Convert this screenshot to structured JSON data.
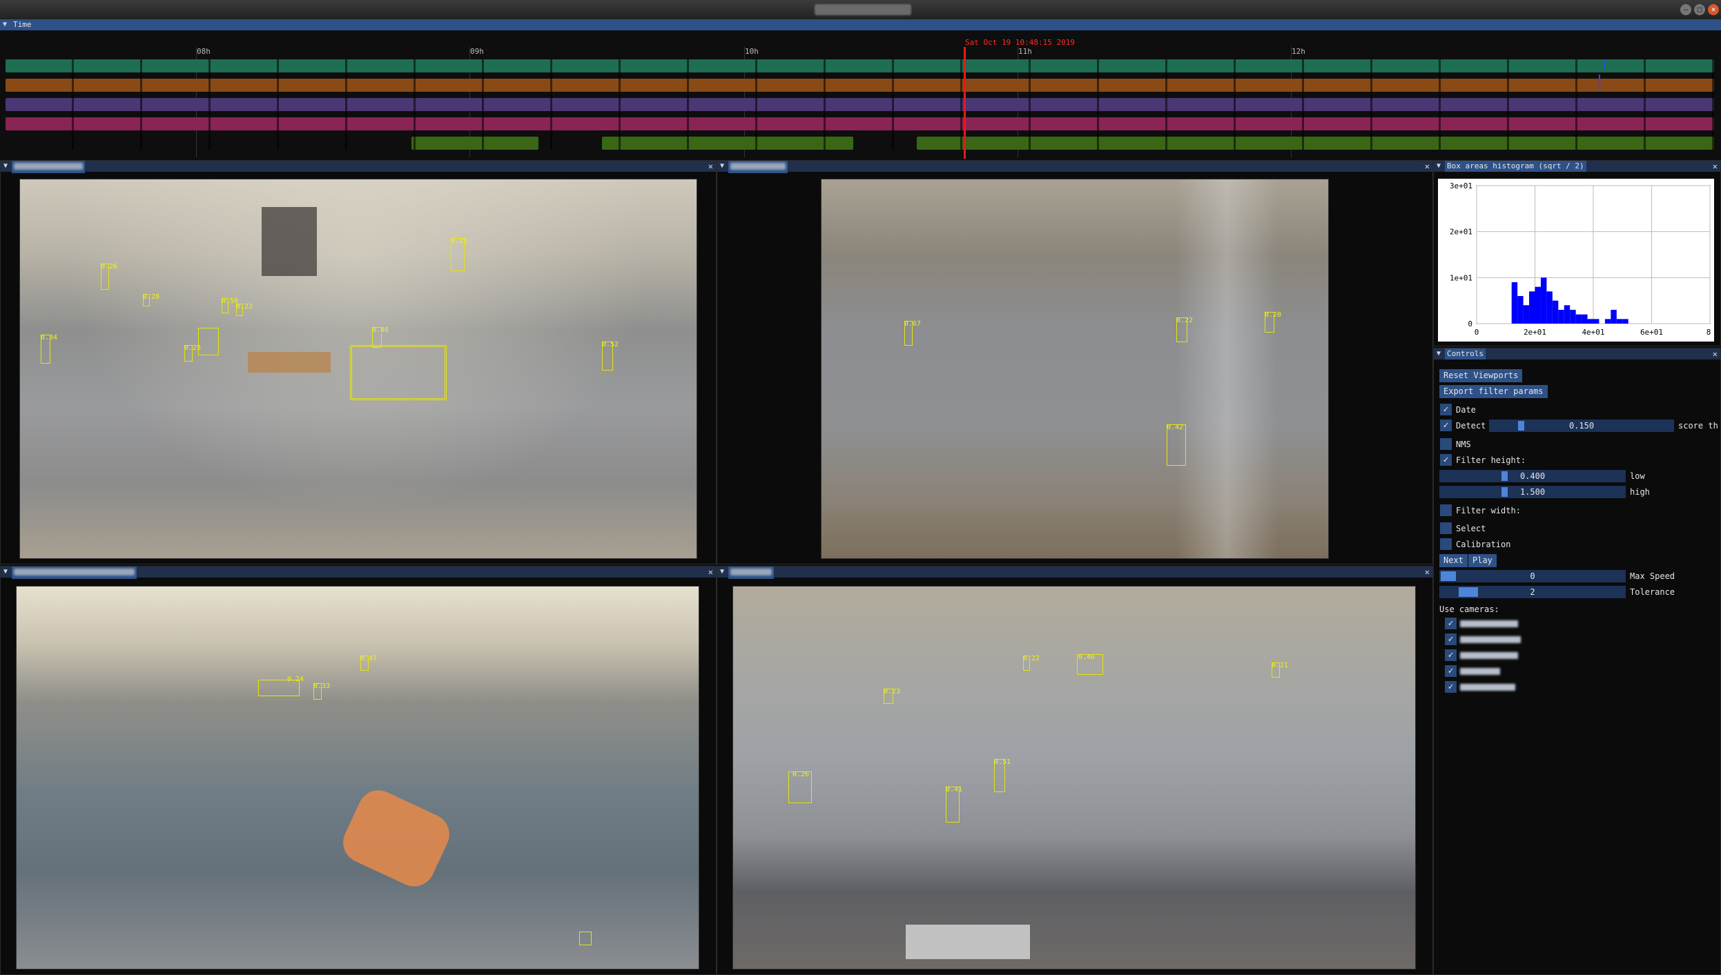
{
  "window": {
    "minimize_glyph": "–",
    "maximize_glyph": "□",
    "close_glyph": "✕"
  },
  "timeline": {
    "window_title": "Time",
    "current_time": "Sat Oct 19 10:48:15 2019",
    "hour_labels": [
      "08h",
      "09h",
      "10h",
      "11h",
      "12h"
    ],
    "track_colors": [
      "#1e6e52",
      "#8a4a16",
      "#4a3773",
      "#8a2454",
      "#3b6616"
    ]
  },
  "views": {
    "top_left": {
      "detections": [
        "0.26",
        "0.28",
        "0.58",
        "0.22",
        "0.34",
        "0.25",
        "0.46",
        "0.21",
        "0.52"
      ]
    },
    "top_right": {
      "detections": [
        "0.67",
        "0.22",
        "0.20",
        "0.42"
      ]
    },
    "bottom_left": {
      "detections": [
        "0.47",
        "0.24",
        "0.33"
      ]
    },
    "bottom_right": {
      "detections": [
        "0.22",
        "0.46",
        "0.21",
        "0.23",
        "0.51",
        "0.41",
        "0.26"
      ]
    }
  },
  "histogram": {
    "window_title": "Box areas histogram (sqrt / 2)",
    "y_ticks": [
      "3e+01",
      "2e+01",
      "1e+01",
      "0"
    ],
    "x_ticks": [
      "0",
      "2e+01",
      "4e+01",
      "6e+01",
      "8"
    ],
    "bar_color": "#0000ff"
  },
  "chart_data": {
    "type": "bar",
    "title": "Box areas histogram (sqrt / 2)",
    "xlim": [
      0,
      80
    ],
    "ylim": [
      0,
      30
    ],
    "bin_width": 2,
    "bins_start": [
      12,
      14,
      16,
      18,
      20,
      22,
      24,
      26,
      28,
      30,
      32,
      34,
      36,
      38,
      40,
      42,
      44,
      46,
      48,
      50
    ],
    "values": [
      9,
      6,
      4,
      7,
      8,
      10,
      7,
      5,
      3,
      4,
      3,
      2,
      2,
      1,
      1,
      0,
      1,
      3,
      1,
      1
    ],
    "grid": true
  },
  "controls": {
    "window_title": "Controls",
    "reset_viewports": "Reset Viewports",
    "export_filter_params": "Export filter params",
    "date_label": "Date",
    "detect_label": "Detect",
    "detect_value": "0.150",
    "detect_fraction": 0.15,
    "detect_suffix": "score th",
    "nms_label": "NMS",
    "filter_height_label": "Filter height:",
    "low_value": "0.400",
    "low_label": "low",
    "high_value": "1.500",
    "high_label": "high",
    "filter_width_label": "Filter width:",
    "select_label": "Select",
    "calibration_label": "Calibration",
    "next_label": "Next",
    "play_label": "Play",
    "max_speed_value": "0",
    "max_speed_label": "Max Speed",
    "tolerance_value": "2",
    "tolerance_label": "Tolerance",
    "use_cameras_label": "Use cameras:",
    "check_glyph": "✓",
    "collapse_glyph": "▼",
    "close_glyph": "✕"
  }
}
